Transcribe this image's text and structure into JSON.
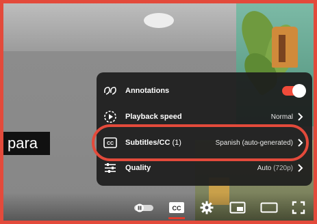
{
  "caption_text": "para",
  "settings_menu": {
    "annotations": {
      "label": "Annotations",
      "enabled": true
    },
    "playback_speed": {
      "label": "Playback speed",
      "value": "Normal"
    },
    "subtitles": {
      "label": "Subtitles/CC",
      "count": "(1)",
      "value": "Spanish (auto-generated)"
    },
    "quality": {
      "label": "Quality",
      "value": "Auto",
      "value_detail": "(720p)"
    }
  },
  "controls": {
    "icons": [
      "autoplay-toggle-icon",
      "cc-icon",
      "gear-icon",
      "miniplayer-icon",
      "theater-icon",
      "fullscreen-icon"
    ],
    "cc_label": "CC"
  },
  "colors": {
    "accent_red": "#e34a3b",
    "toggle_on": "#f04b3a",
    "menu_bg": "#1c1c1c"
  }
}
